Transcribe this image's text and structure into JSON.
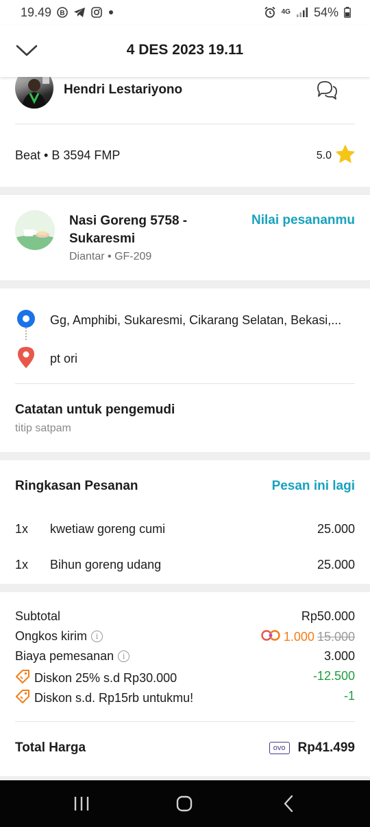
{
  "status_bar": {
    "time": "19.49",
    "network": "4G",
    "battery": "54%",
    "icons": [
      "b-badge-icon",
      "telegram-icon",
      "instagram-icon",
      "dot-icon",
      "alarm-icon",
      "signal-icon",
      "battery-icon"
    ]
  },
  "header": {
    "title": "4 DES 2023 19.11",
    "back_icon": "chevron-down-icon"
  },
  "driver": {
    "name": "Hendri Lestariyono",
    "vehicle": "Beat • B 3594 FMP",
    "rating": "5.0"
  },
  "restaurant": {
    "name": "Nasi Goreng 5758 - Sukaresmi",
    "subtitle": "Diantar • GF-209",
    "rate_link": "Nilai pesananmu"
  },
  "locations": {
    "pickup": "Gg, Amphibi, Sukaresmi, Cikarang Selatan, Bekasi,...",
    "dropoff": "pt ori"
  },
  "note": {
    "title": "Catatan untuk pengemudi",
    "text": "titip satpam"
  },
  "summary": {
    "title": "Ringkasan Pesanan",
    "reorder": "Pesan ini lagi",
    "items": [
      {
        "qty": "1x",
        "name": "kwetiaw goreng cumi",
        "price": "25.000"
      },
      {
        "qty": "1x",
        "name": "Bihun goreng udang",
        "price": "25.000"
      }
    ]
  },
  "pricing": {
    "subtotal_label": "Subtotal",
    "subtotal_value": "Rp50.000",
    "delivery_label": "Ongkos kirim",
    "delivery_value": "1.000",
    "delivery_original": "15.000",
    "order_fee_label": "Biaya pemesanan",
    "order_fee_value": "3.000",
    "discount1_label": "Diskon 25% s.d Rp30.000",
    "discount1_value": "-12.500",
    "discount2_label": "Diskon s.d. Rp15rb untukmu!",
    "discount2_value": "-1",
    "total_label": "Total Harga",
    "payment_method": "ovo",
    "total_value": "Rp41.499"
  },
  "colors": {
    "accent": "#17a2be",
    "discount": "#1e9e3e",
    "promo": "#f47d16",
    "star": "#f5c518",
    "pickup": "#1a73e8",
    "dropoff": "#e8584a"
  }
}
